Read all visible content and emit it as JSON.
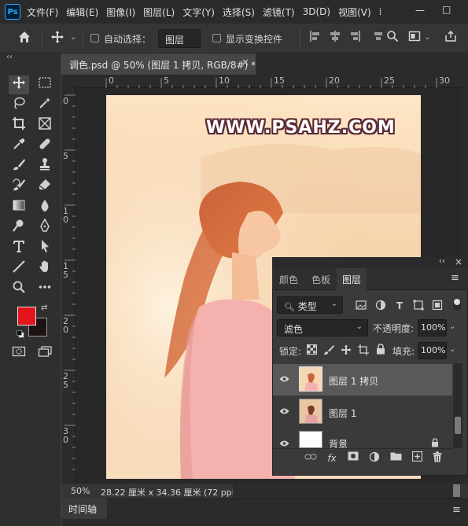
{
  "app": {
    "logo": "Ps"
  },
  "menu": {
    "items": [
      "文件(F)",
      "编辑(E)",
      "图像(I)",
      "图层(L)",
      "文字(Y)",
      "选择(S)",
      "滤镜(T)",
      "3D(D)",
      "视图(V)"
    ],
    "overflow": "⁞",
    "minimize": "—",
    "maximize": "□"
  },
  "options_bar": {
    "home_icon": "home-icon",
    "move_icon": "move-icon",
    "auto_select_label": "自动选择：",
    "auto_select_value": "图层",
    "show_transform_label": "显示变换控件",
    "search_icon": "search-icon",
    "workspace_icon": "workspace-icon",
    "share_icon": "share-icon"
  },
  "document": {
    "tab_title": "调色.psd @ 50% (图层 1 拷贝, RGB/8#) *",
    "close": "×",
    "watermark": "WWW.PSAHZ.COM",
    "ruler_top": [
      "0",
      "5",
      "10",
      "15",
      "20",
      "25",
      "30"
    ],
    "ruler_left": [
      "0",
      "5",
      "1\n0",
      "1\n5",
      "2\n0",
      "2\n5",
      "3\n0"
    ]
  },
  "status": {
    "zoom": "50%",
    "doc_size": "28.22 厘米 x 34.36 厘米 (72 ppi)",
    "arrow": "›"
  },
  "timeline": {
    "label": "时间轴"
  },
  "toolbar": {
    "collapse": "‹‹",
    "foreground_color": "#e3141c",
    "background_color": "#1e1212"
  },
  "layers_panel": {
    "collapse": "‹‹",
    "close": "×",
    "tabs": [
      "颜色",
      "色板",
      "图层"
    ],
    "active_tab": "图层",
    "menu_icon": "≡",
    "filter_kind": "类型",
    "blend_mode": "滤色",
    "opacity_label": "不透明度:",
    "opacity_value": "100%",
    "lock_label": "锁定:",
    "fill_label": "填充:",
    "fill_value": "100%",
    "layers": [
      {
        "name": "图层 1 拷贝",
        "selected": true
      },
      {
        "name": "图层 1",
        "selected": false
      },
      {
        "name": "背景",
        "selected": false,
        "locked": true
      }
    ]
  }
}
